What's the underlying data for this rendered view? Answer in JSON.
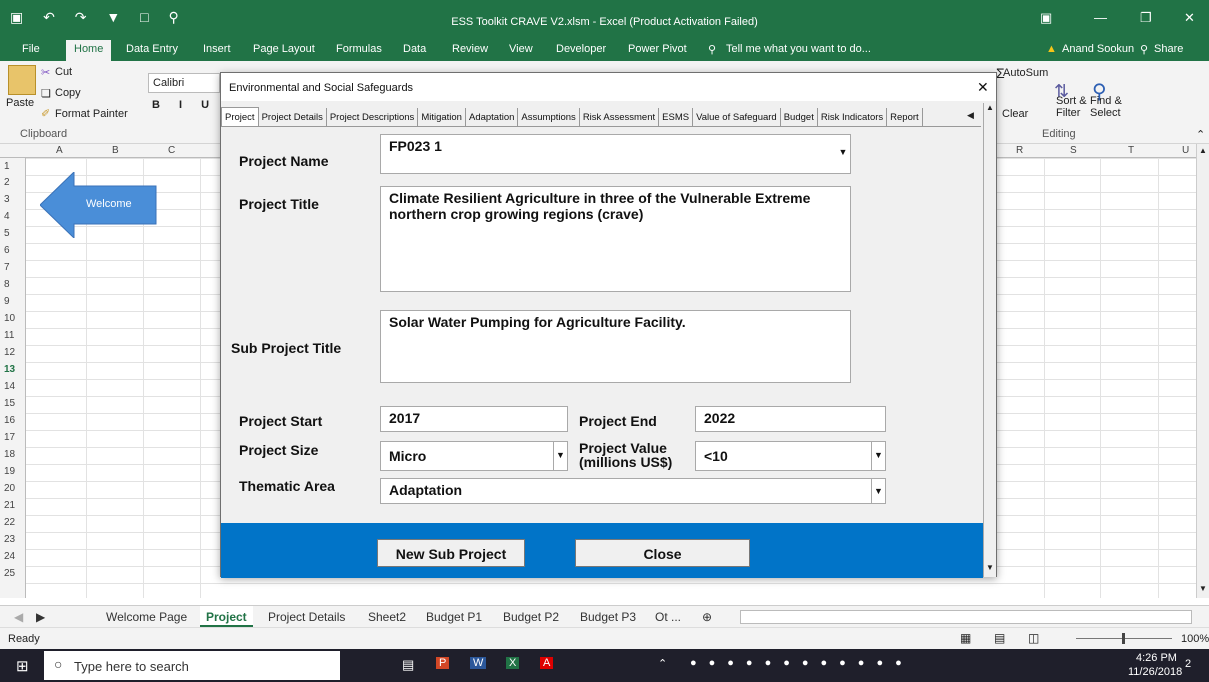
{
  "window": {
    "title": "ESS Toolkit CRAVE V2.xlsm - Excel (Product Activation Failed)",
    "user": "Anand Sookun",
    "share_label": "Share"
  },
  "ribbon_tabs": [
    "File",
    "Home",
    "Data Entry",
    "Insert",
    "Page Layout",
    "Formulas",
    "Data",
    "Review",
    "View",
    "Developer",
    "Power Pivot"
  ],
  "tell_me": "Tell me what you want to do...",
  "ribbon": {
    "paste": "Paste",
    "cut": "Cut",
    "copy": "Copy",
    "format_painter": "Format Painter",
    "clipboard": "Clipboard",
    "font_name": "Calibri",
    "autosum": "AutoSum",
    "sort_filter": "Sort & Filter",
    "find_select": "Find & Select",
    "clear": "Clear",
    "editing": "Editing"
  },
  "columns_left": [
    "A",
    "B",
    "C"
  ],
  "columns_right": [
    "R",
    "S",
    "T",
    "U"
  ],
  "rows": [
    "1",
    "2",
    "3",
    "4",
    "5",
    "6",
    "7",
    "8",
    "9",
    "10",
    "11",
    "12",
    "13",
    "14",
    "15",
    "16",
    "17",
    "18",
    "19",
    "20",
    "21",
    "22",
    "23",
    "24",
    "25"
  ],
  "welcome_arrow_label": "Welcome",
  "sheet_tabs": [
    "Welcome Page",
    "Project",
    "Project Details",
    "Sheet2",
    "Budget P1",
    "Budget P2",
    "Budget P3",
    "Ot ..."
  ],
  "status": {
    "ready": "Ready",
    "zoom": "100%"
  },
  "taskbar": {
    "search": "Type here to search",
    "time": "4:26 PM",
    "date": "11/26/2018",
    "notifications": "2"
  },
  "dialog": {
    "title": "Environmental and Social Safeguards",
    "tabs": [
      "Project",
      "Project Details",
      "Project Descriptions",
      "Mitigation",
      "Adaptation",
      "Assumptions",
      "Risk Assessment",
      "ESMS",
      "Value of Safeguard",
      "Budget",
      "Risk Indicators",
      "Report"
    ],
    "labels": {
      "project_name": "Project Name",
      "project_title": "Project Title",
      "sub_project_title": "Sub Project Title",
      "project_start": "Project Start",
      "project_end": "Project End",
      "project_size": "Project Size",
      "project_value_line1": "Project Value",
      "project_value_line2": "(millions US$)",
      "thematic_area": "Thematic Area"
    },
    "values": {
      "project_name": "FP023 1",
      "project_title": "Climate Resilient Agriculture in three of the Vulnerable Extreme northern crop growing regions (crave)",
      "sub_project_title": "Solar Water Pumping for Agriculture Facility.",
      "project_start": "2017",
      "project_end": "2022",
      "project_size": "Micro",
      "project_value": "<10",
      "thematic_area": "Adaptation"
    },
    "buttons": {
      "new_sub_project": "New Sub Project",
      "close": "Close"
    }
  },
  "colors": {
    "excel_green": "#217346",
    "dialog_bottom_blue": "#0174c8",
    "arrow_blue": "#4a8ed8"
  }
}
